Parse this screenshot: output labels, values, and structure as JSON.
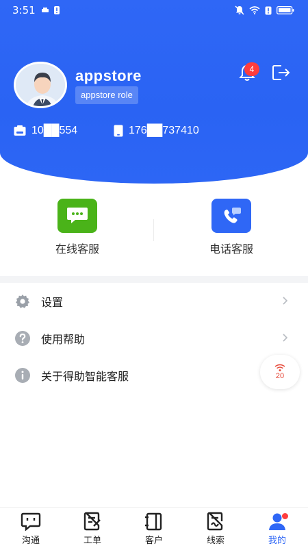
{
  "status_bar": {
    "time": "3:51"
  },
  "profile": {
    "username": "appstore",
    "role": "appstore role",
    "account_id": "10██554",
    "phone": "176██737410",
    "notification_count": "4"
  },
  "services": [
    {
      "label": "在线客服",
      "icon": "chat-bubble-icon",
      "color": "#4ab319"
    },
    {
      "label": "电话客服",
      "icon": "phone-call-icon",
      "color": "#2f67f6"
    }
  ],
  "menu": [
    {
      "label": "设置",
      "icon": "gear-icon"
    },
    {
      "label": "使用帮助",
      "icon": "question-icon"
    },
    {
      "label": "关于得助智能客服",
      "icon": "info-icon"
    }
  ],
  "float_button": {
    "count": "20",
    "icon": "wifi-signal-icon"
  },
  "tabs": [
    {
      "label": "沟通",
      "icon": "chat-icon"
    },
    {
      "label": "工单",
      "icon": "ticket-icon"
    },
    {
      "label": "客户",
      "icon": "customer-icon"
    },
    {
      "label": "线索",
      "icon": "clue-icon"
    },
    {
      "label": "我的",
      "icon": "profile-icon"
    }
  ],
  "colors": {
    "brand": "#2f67f6",
    "badge": "#ff3d3d",
    "online_service": "#4ab319"
  }
}
